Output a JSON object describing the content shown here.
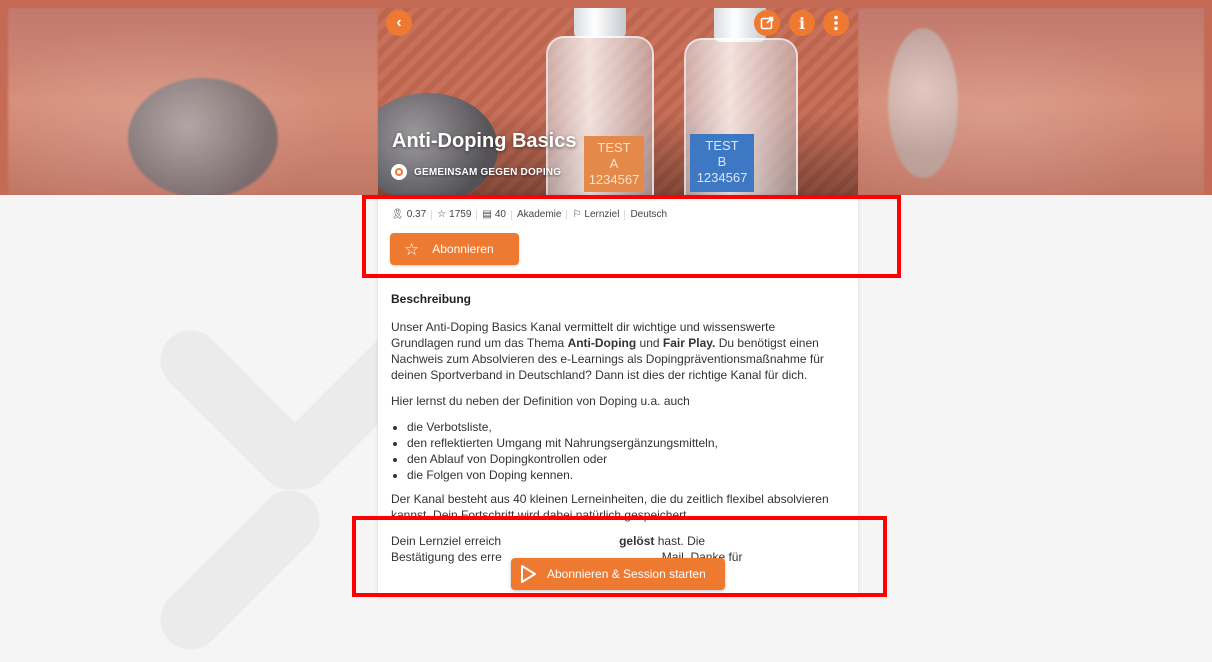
{
  "channel": {
    "title": "Anti-Doping Basics",
    "organization": "GEMEINSAM GEGEN DOPING",
    "bottle_labels": {
      "a": "TEST\nA\n1234567",
      "b": "TEST\nB\n1234567"
    }
  },
  "header_buttons": {
    "back_icon": "chevron-left-icon",
    "share_icon": "external-link-icon",
    "info_icon": "info-icon",
    "more_icon": "more-vertical-icon"
  },
  "meta": {
    "rating": "0.37",
    "subscribers": "1759",
    "lessons": "40",
    "category": "Akademie",
    "goal": "Lernziel",
    "language": "Deutsch"
  },
  "subscribe_button": {
    "label": "Abonnieren",
    "icon": "star-outline-icon"
  },
  "description": {
    "heading": "Beschreibung",
    "p1_a": "Unser Anti-Doping Basics Kanal vermittelt dir wichtige und wissenswerte Grundlagen rund um das Thema ",
    "p1_b1": "Anti-Doping",
    "p1_c": " und ",
    "p1_b2": "Fair Play.",
    "p1_d": " Du benötigst einen Nachweis zum Absolvieren des e-Learnings als Dopingpräventionsmaßnahme für deinen Sportverband in Deutschland? Dann ist dies der richtige Kanal für dich.",
    "p2": "Hier lernst du neben der Definition von Doping u.a. auch",
    "list": [
      "die Verbotsliste,",
      "den reflektierten Umgang mit Nahrungsergänzungsmitteln,",
      "den Ablauf von Dopingkontrollen oder",
      "die Folgen von Doping kennen."
    ],
    "p3": "Der Kanal besteht aus 40 kleinen Lerneinheiten, die du zeitlich flexibel absolvieren kannst. Dein Fortschritt wird dabei natürlich gespeichert.",
    "p4_a": "Dein Lernziel erreich",
    "p4_b": "gelöst",
    "p4_c": " hast. Die",
    "p5": "Bestätigung des erre                                                Mail. Danke für"
  },
  "cta_button": {
    "label": "Abonnieren & Session starten",
    "icon": "play-outline-icon"
  },
  "colors": {
    "accent": "#ee7a31",
    "highlight": "#ff0000"
  }
}
